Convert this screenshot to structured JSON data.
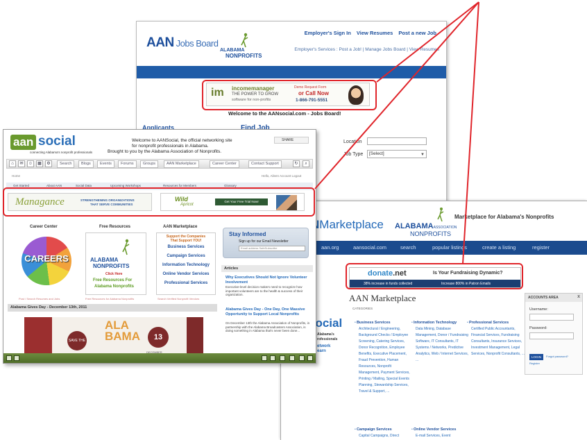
{
  "jobs_board": {
    "logo_main": "AAN",
    "logo_sub": "Jobs Board",
    "ala_line1": "ALABAMA",
    "ala_line2": "NONPROFITS",
    "top_links": [
      "Employer's Sign In",
      "View Resumes",
      "Post a new Job"
    ],
    "sub_links": "Employer's Services : Post a Job! | Manage Jobs Board | View Resumes",
    "ad": {
      "mark": "im",
      "brand": "incomemanager",
      "tag1": "THE POWER TO GROW",
      "tag2": "software for non-profits",
      "call_top": "Demo Request Form",
      "call_mid": "or Call Now",
      "phone": "1-866-791-5551"
    },
    "welcome": "Welcome to the AANsocial.com - Jobs Board!",
    "applicants_heading": "Applicants",
    "find_job_heading": "Find Job",
    "location_label": "Location",
    "job_type_label": "Job Type",
    "job_type_value": "[Select]"
  },
  "marketplace": {
    "logo": "Marketplace",
    "logo_prefix": "N",
    "ala_line1": "ALABAMA",
    "ala_assoc": "ASSOCIATION",
    "ala_line2": "NONPROFITS",
    "tagline": "Marketplace for Alabama's Nonprofits",
    "nav": [
      "aan.org",
      "aansocial.com",
      "search",
      "popular listings",
      "create a listing",
      "register"
    ],
    "ad": {
      "brand": "donate",
      "brand_tld": ".net",
      "question": "Is Your Fundraising Dynamic?",
      "stat1": "38% increase in funds collected",
      "stat2": "Increase 800% in Patron Emails"
    },
    "title": "AAN Marketplace",
    "categories_label": "CATEGORIES",
    "social_logo": "social",
    "social_t1": "Alabama's",
    "social_t2": "rofessionals",
    "social_t3": "etwork",
    "social_t4": "earn",
    "columns": [
      {
        "heading": "Business Services",
        "body": "Architectural / Engineering, Background Checks / Employee Screening, Catering Services, Donor Recognition, Employee Benefits, Executive Placement, Fraud Prevention, Human Resources, Nonprofit Management, Payment Services, Printing / Mailing, Special Events Planning, Stewardship Services, Travel & Support, ..."
      },
      {
        "heading": "Information Technology",
        "body": "Data Mining, Database Management, Donor / Fundraising Software, IT Consultants, IT Systems / Networks, Predictive Analytics, Web / Internet Services, ..."
      },
      {
        "heading": "Professional Services",
        "body": "Certified Public Accountants, Financial Services, Fundraising Consultants, Insurance Services, Investment Management, Legal Services, Nonprofit Consultants, ..."
      }
    ],
    "columns_lower": [
      {
        "heading": "Campaign Services",
        "body": "Capital Campaigns, Direct"
      },
      {
        "heading": "Online Vendor Services",
        "body": "E-mail Services, Event"
      }
    ],
    "account": {
      "heading": "ACCOUNTS AREA",
      "close": "x",
      "username_label": "Username:",
      "password_label": "Password:",
      "login": "LOGIN",
      "forgot": "Forgot password?",
      "register": "Register"
    }
  },
  "social": {
    "logo_aan": "aan",
    "logo_social": "social",
    "logo_sub": "connecting Alabama's nonprofit professionals",
    "welcome1": "Welcome to AANSocial, the official networking site",
    "welcome2": "for nonprofit professionals in Alabama.",
    "welcome3": "Brought to you by the Alabama Association of Nonprofits.",
    "share": "SHARE",
    "toolbar": [
      "Search",
      "Blogs",
      "Events",
      "Forums",
      "Groups",
      "AAN Marketplace",
      "Career Center",
      "Contact Support"
    ],
    "crumb": "Home",
    "hello": "Hello, Aileen  Account Logout",
    "nav2": [
      "Get Started",
      "About AAN",
      "Social Data",
      "Upcoming Workshops",
      "Resources for Members",
      "Glossary"
    ],
    "banner1": {
      "brand": "Managance",
      "t1": "STRENGTHENING ORGANIZATIONS",
      "t2": "THAT SERVE COMMUNITIES"
    },
    "banner2": {
      "brand": "Wild",
      "brand2": "Apricot",
      "button": "Get Your Free Trial Now!"
    },
    "col_heads": [
      "Career Center",
      "Free Resources",
      "AAN Marketplace"
    ],
    "careers_word": "CAREERS",
    "ala": {
      "l1": "ALABAMA",
      "l2": "NONPROFITS",
      "click": "Click Here",
      "free1": "Free Resources For",
      "free2": "Alabama Nonprofits"
    },
    "mkt_box": {
      "tag1": "Support the Companies",
      "tag2": "That Support YOU!",
      "links": [
        "Business Services",
        "Campaign Services",
        "Information Technology",
        "Online Vendor Services",
        "Professional Services"
      ]
    },
    "col_foots": [
      "Post / Search Resumes and Jobs",
      "Free Resources for Alabama Nonprofits",
      "Search Verified Nonprofit Vendors"
    ],
    "gives_bar": "Alabama Gives Day - December 13th, 2011",
    "gives": {
      "save": "SAVE THE DATE",
      "ala": "ALA",
      "bama": "BAMA",
      "day": "13",
      "dec": "DECEMBER"
    },
    "stay": {
      "heading": "Stay Informed",
      "text": "Sign up for our Email Newsletter",
      "placeholder": "Email address  SafeSubscribe"
    },
    "articles_heading": "Articles",
    "articles": [
      {
        "title": "Why Executives Should Not Ignore Volunteer Involvement",
        "body": "Executive-level decision makers need to recognize how important volunteers are to the health & success of their organization."
      },
      {
        "title": "Alabama Gives Day - One Day, One Massive Opportunity to Support Local Nonprofits",
        "body": "On December 13th the Alabama Association of Nonprofits, in partnership with the Alabama Broadcasters Association, is doing something in Alabama that's never been done..."
      }
    ]
  },
  "colors": {
    "callout": "#e0242a",
    "aan_blue": "#1d4f9c",
    "aan_green": "#6a9a2e"
  }
}
